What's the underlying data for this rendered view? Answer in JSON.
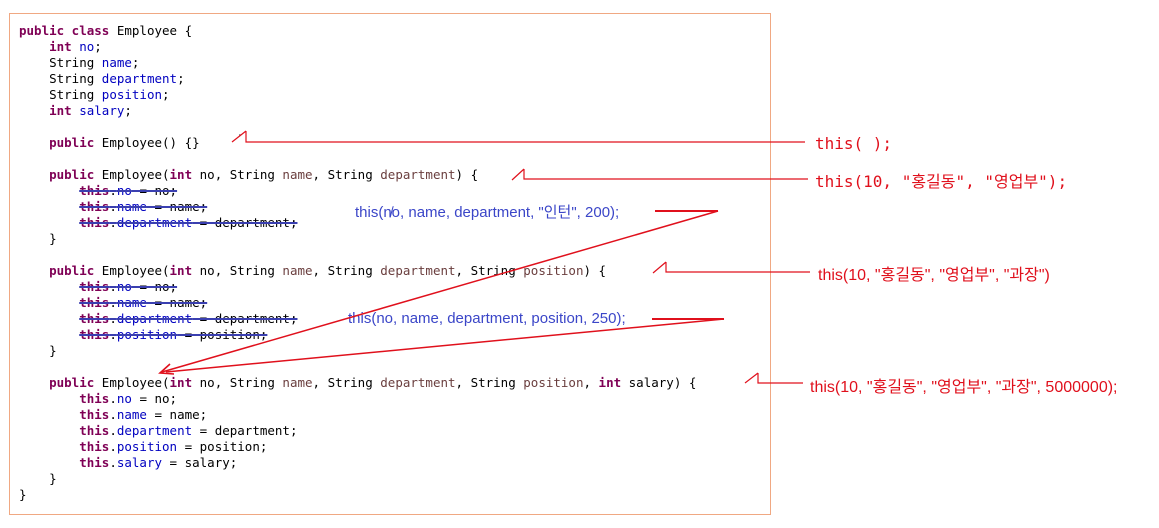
{
  "code": {
    "l1": {
      "kw1": "public class",
      "rest": " Employee {"
    },
    "l2": {
      "kw": "int",
      "fld": "no",
      "end": ";"
    },
    "l3": {
      "type": "String ",
      "fld": "name",
      "end": ";"
    },
    "l4": {
      "type": "String ",
      "fld": "department",
      "end": ";"
    },
    "l5": {
      "type": "String ",
      "fld": "position",
      "end": ";"
    },
    "l6": {
      "kw": "int",
      "fld": "salary",
      "end": ";"
    },
    "c1": {
      "kw": "public",
      "rest": " Employee() {}"
    },
    "c2": {
      "kw": "public",
      "name": " Employee(",
      "t1": "int",
      "p1": " no",
      "s1": ", String ",
      "p2": "name",
      "s2": ", String ",
      "p3": "department",
      "end": ") {"
    },
    "c2a": {
      "kw": "this",
      "fld": "no",
      "mid": " = no;"
    },
    "c2b": {
      "kw": "this",
      "fld": "name",
      "mid": " = name;"
    },
    "c2c": {
      "kw": "this",
      "fld": "department",
      "mid": " = department;"
    },
    "close1": "}",
    "c3": {
      "kw": "public",
      "name": " Employee(",
      "t1": "int",
      "p1": " no",
      "s1": ", String ",
      "p2": "name",
      "s2": ", String ",
      "p3": "department",
      "s3": ", String ",
      "p4": "position",
      "end": ") {"
    },
    "c3a": {
      "kw": "this",
      "fld": "no",
      "mid": " = no;"
    },
    "c3b": {
      "kw": "this",
      "fld": "name",
      "mid": " = name;"
    },
    "c3c": {
      "kw": "this",
      "fld": "department",
      "mid": " = department;"
    },
    "c3d": {
      "kw": "this",
      "fld": "position",
      "mid": " = position;"
    },
    "close2": "}",
    "c4": {
      "kw": "public",
      "name": " Employee(",
      "t1": "int",
      "p1": " no",
      "s1": ", String ",
      "p2": "name",
      "s2": ", String ",
      "p3": "department",
      "s3": ", String ",
      "p4": "position",
      "s4": ", ",
      "t2": "int",
      "p5": " salary",
      "end": ") {"
    },
    "c4a": {
      "kw": "this",
      "fld": "no",
      "mid": " = no;"
    },
    "c4b": {
      "kw": "this",
      "fld": "name",
      "mid": " = name;"
    },
    "c4c": {
      "kw": "this",
      "fld": "department",
      "mid": " = department;"
    },
    "c4d": {
      "kw": "this",
      "fld": "position",
      "mid": " = position;"
    },
    "c4e": {
      "kw": "this",
      "fld": "salary",
      "mid": " = salary;"
    },
    "close3": "}",
    "close4": "}",
    "dot": "."
  },
  "inline_notes": {
    "note1": "this(n̸o, name, department, \"인턴\", 200);",
    "note2": "this(no, name, department, position, 250);"
  },
  "annotations": {
    "a1": "this( );",
    "a2": "this(10, \"홍길동\", \"영업부\");",
    "a3": "this(10, \"홍길동\", \"영업부\", \"과장\")",
    "a4": "this(10, \"홍길동\", \"영업부\", \"과장\", 5000000);"
  },
  "colors": {
    "annotation_red": "#e0101c",
    "note_blue": "#3b46c8",
    "strike_blue": "#3a3fb0",
    "box_border": "#f0a882"
  }
}
